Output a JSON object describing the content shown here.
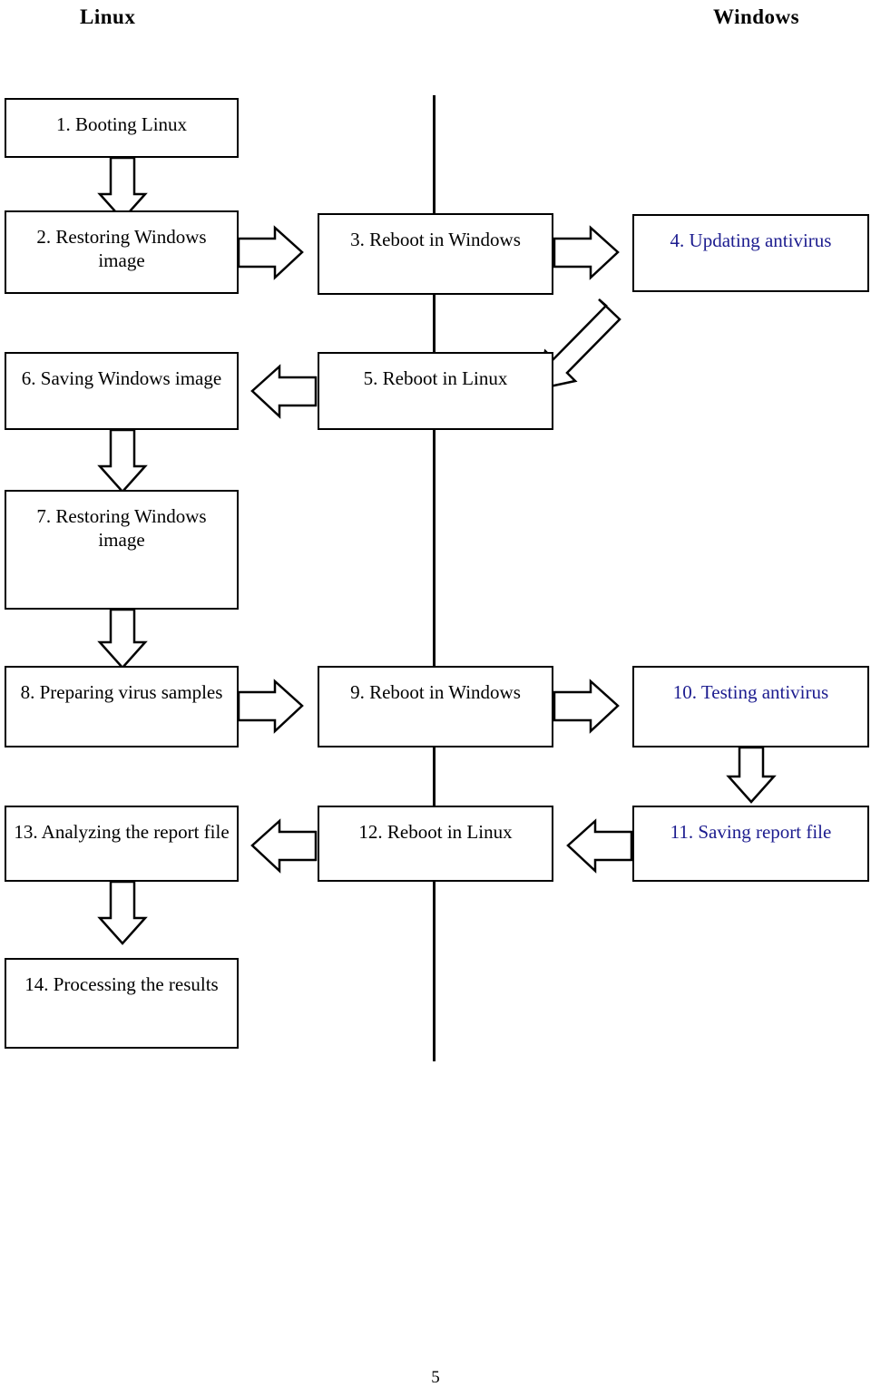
{
  "headers": {
    "left": "Linux",
    "right": "Windows"
  },
  "page_number": "5",
  "colors": {
    "text": "#000000",
    "highlight": "#1c1c8f",
    "stroke": "#000000",
    "background": "#ffffff"
  },
  "nodes": [
    {
      "id": "n1",
      "label": "1. Booting Linux",
      "column": "linux",
      "highlight": false
    },
    {
      "id": "n2",
      "label": "2. Restoring Windows image",
      "column": "linux",
      "highlight": false
    },
    {
      "id": "n3",
      "label": "3. Reboot in Windows",
      "column": "middle",
      "highlight": false
    },
    {
      "id": "n4",
      "label": "4. Updating antivirus",
      "column": "windows",
      "highlight": true
    },
    {
      "id": "n5",
      "label": "5. Reboot in Linux",
      "column": "middle",
      "highlight": false
    },
    {
      "id": "n6",
      "label": "6. Saving Windows image",
      "column": "linux",
      "highlight": false
    },
    {
      "id": "n7",
      "label": "7. Restoring Windows image",
      "column": "linux",
      "highlight": false
    },
    {
      "id": "n8",
      "label": "8. Preparing virus samples",
      "column": "linux",
      "highlight": false
    },
    {
      "id": "n9",
      "label": "9. Reboot in Windows",
      "column": "middle",
      "highlight": false
    },
    {
      "id": "n10",
      "label": "10. Testing antivirus",
      "column": "windows",
      "highlight": true
    },
    {
      "id": "n11",
      "label": "11. Saving report file",
      "column": "windows",
      "highlight": true
    },
    {
      "id": "n12",
      "label": "12. Reboot in Linux",
      "column": "middle",
      "highlight": false
    },
    {
      "id": "n13",
      "label": "13. Analyzing the report file",
      "column": "linux",
      "highlight": false
    },
    {
      "id": "n14",
      "label": "14. Processing the results",
      "column": "linux",
      "highlight": false
    }
  ],
  "edges": [
    {
      "from": "n1",
      "to": "n2",
      "direction": "down"
    },
    {
      "from": "n2",
      "to": "n3",
      "direction": "right"
    },
    {
      "from": "n3",
      "to": "n4",
      "direction": "right"
    },
    {
      "from": "n4",
      "to": "n5",
      "direction": "down-left"
    },
    {
      "from": "n5",
      "to": "n6",
      "direction": "left"
    },
    {
      "from": "n6",
      "to": "n7",
      "direction": "down"
    },
    {
      "from": "n7",
      "to": "n8",
      "direction": "down"
    },
    {
      "from": "n8",
      "to": "n9",
      "direction": "right"
    },
    {
      "from": "n9",
      "to": "n10",
      "direction": "right"
    },
    {
      "from": "n10",
      "to": "n11",
      "direction": "down"
    },
    {
      "from": "n11",
      "to": "n12",
      "direction": "left"
    },
    {
      "from": "n12",
      "to": "n13",
      "direction": "left"
    },
    {
      "from": "n13",
      "to": "n14",
      "direction": "down"
    }
  ]
}
